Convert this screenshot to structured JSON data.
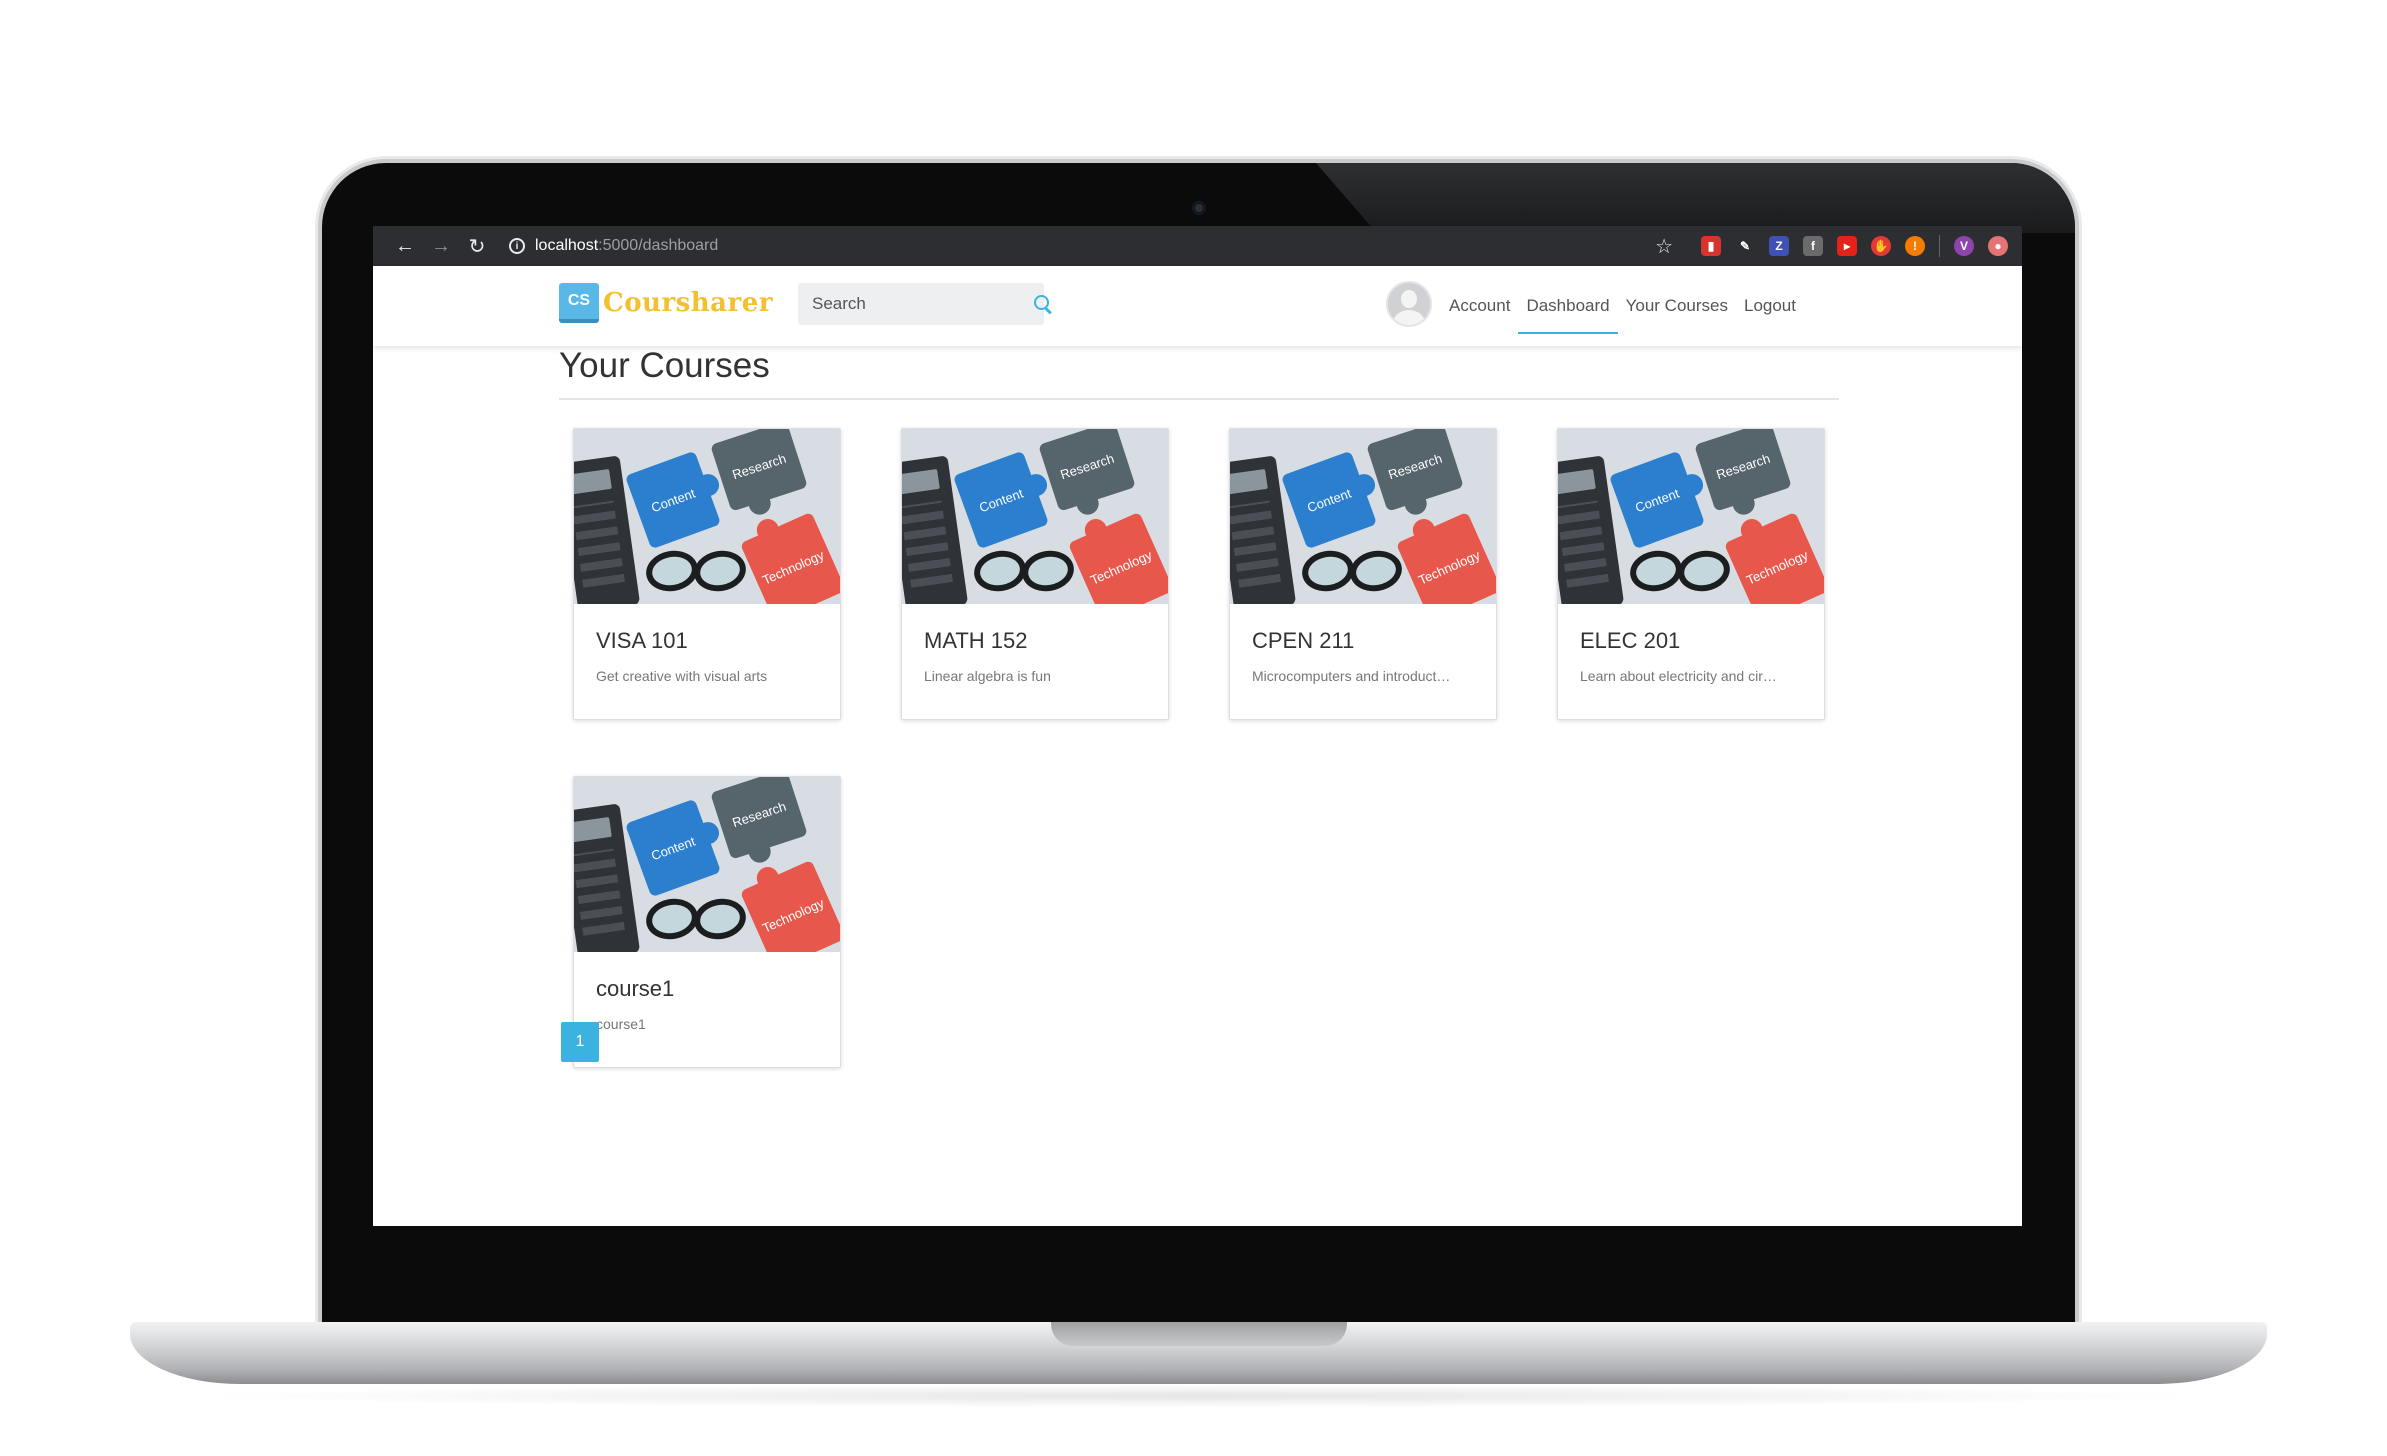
{
  "browser": {
    "url_host": "localhost",
    "url_path": ":5000/dashboard",
    "extensions": [
      {
        "name": "bookmark-ext-icon",
        "color": "#d8342f",
        "glyph": "▮"
      },
      {
        "name": "pen-ext-icon",
        "color": "#2d2e31",
        "glyph": "✎"
      },
      {
        "name": "zotero-ext-icon",
        "color": "#3f51b5",
        "glyph": "Z"
      },
      {
        "name": "facebook-ext-icon",
        "color": "#6b6b6b",
        "glyph": "f"
      },
      {
        "name": "video-ext-icon",
        "color": "#e62117",
        "glyph": "▸"
      },
      {
        "name": "hand-ext-icon",
        "color": "#e53935",
        "glyph": "✋"
      },
      {
        "name": "alert-ext-icon",
        "color": "#f57c00",
        "glyph": "!"
      },
      {
        "name": "profile-avatar-icon",
        "color": "#8e44ad",
        "glyph": "V"
      },
      {
        "name": "update-ext-icon",
        "color": "#e57373",
        "glyph": "●"
      }
    ]
  },
  "site": {
    "logo_badge": "CS",
    "logo_text": "Coursharer",
    "search_placeholder": "Search",
    "nav": {
      "account": "Account",
      "dashboard": "Dashboard",
      "your_courses": "Your Courses",
      "logout": "Logout"
    },
    "accent_color": "#3bb3e0"
  },
  "main": {
    "title": "Your Courses",
    "image_labels": {
      "content": "Content",
      "research": "Research",
      "technology": "Technology"
    },
    "courses": [
      {
        "code": "VISA 101",
        "description": "Get creative with visual arts"
      },
      {
        "code": "MATH 152",
        "description": "Linear algebra is fun"
      },
      {
        "code": "CPEN 211",
        "description": "Microcomputers and introduct…"
      },
      {
        "code": "ELEC 201",
        "description": "Learn about electricity and cir…"
      },
      {
        "code": "course1",
        "description": "course1"
      }
    ],
    "pagination": {
      "current": "1"
    }
  }
}
